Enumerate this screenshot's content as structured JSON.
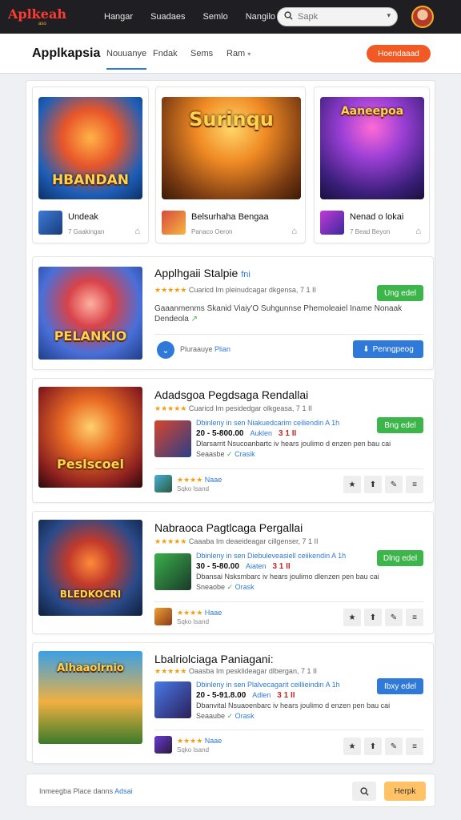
{
  "topbar": {
    "logo": "Aplkeah",
    "logo_sub": "aso",
    "nav": [
      "Hangar",
      "Suadaes",
      "Semlo",
      "Nangilo"
    ],
    "search_placeholder": "Sapk",
    "search_icon": "search-icon",
    "avatar_icon": "avatar"
  },
  "subnav": {
    "title": "Applkapsia",
    "tabs": [
      "Nouuanye",
      "Fndak",
      "Sems",
      "Ram"
    ],
    "cta": "Hoendaaad"
  },
  "tiles": [
    {
      "art_title": "HBANDAN",
      "name": "Undeak",
      "sub": "7 Gaakingan"
    },
    {
      "art_title": "Surinqu",
      "name": "Belsurhaha Bengaa",
      "sub": "Panaco Oeron"
    },
    {
      "art_title": "Aaneepoa",
      "name": "Nenad o lokai",
      "sub": "7 Bead Beyon"
    }
  ],
  "featured": {
    "art_label": "PELANKIO",
    "title": "Applhgaii  Stalpie",
    "title_suffix": "fni",
    "stars": "★★★★★",
    "rating_text": "Cuaricd Im pleinudcagar dkgensa, 7 1 II",
    "badge": "Ung edel",
    "desc": "Gaaanmenms Skanid Viaiy'O Suhgunnse Phemoleaiel Iname Nonaak Dendeola",
    "info_icon": "chevron-down-icon",
    "info_text": "Pluraauye",
    "info_link": "Plian",
    "download": "Penngpeog"
  },
  "cards": [
    {
      "art_label": "Peslscoel",
      "title": "Adadsgoa  Pegdsaga  Rendallai",
      "stars": "★★★★★",
      "rating_text": "Cuaricd Im pesidedgar olkgeasa, 7 1 II",
      "badge": "Bng edel",
      "badge_color": "green",
      "l1": "Dbinleny in sen Niakuedcarim ceiliendin A 1h",
      "l2_price": "20 - 5-800.00",
      "l2_a": "Auklen",
      "l2_s": "3 1 II",
      "l3": "Dlarsarrit Nsucoanbartc iv hears joulimo d enzen pen bau cai",
      "l4_pre": "Seaasbe",
      "l4_ok": "✓",
      "l4_cr": "Crasik",
      "mini_stars": "★★★★",
      "mini_new": "Naae",
      "mini_sub": "Sqko Isand"
    },
    {
      "art_label": "BLEDKOCRI",
      "title": "Nabraoca  Pagtlcaga  Pergallai",
      "stars": "★★★★★",
      "rating_text": "Caaaba Im deaeideagar cillgenser, 7 1 II",
      "badge": "Dlng edel",
      "badge_color": "green",
      "l1": "Dbinleny in sen Diebuleveasiell ceiikendin A 1h",
      "l2_price": "30 - 5-80.00",
      "l2_a": "Aiaten",
      "l2_s": "3 1 II",
      "l3": "Dbansai Nsksmbarc iv hears joulimo dlenzen pen bau cai",
      "l4_pre": "Sneaobe",
      "l4_ok": "✓",
      "l4_cr": "Orask",
      "mini_stars": "★★★★",
      "mini_new": "Haae",
      "mini_sub": "Sqko Isand"
    },
    {
      "art_label": "Alhaaolrnio",
      "title": "Lbalriolciaga  Paniagani:",
      "stars": "★★★★★",
      "rating_text": "Oaasba Im pesklideagar dlbergan, 7 1 II",
      "badge": "Ibxy edel",
      "badge_color": "blue",
      "l1": "Dbinleny in sen Plalvecagarit ceillieindin A 1h",
      "l2_price": "20 - 5-91.8.00",
      "l2_a": "Adlen",
      "l2_s": "3 1 II",
      "l3": "Dbanvital Nsuaoenbarc iv hears joulimo d enzen pen bau cai",
      "l4_pre": "Seaaube",
      "l4_ok": "✓",
      "l4_cr": "Orask",
      "mini_stars": "★★★★",
      "mini_new": "Naae",
      "mini_sub": "Sqko Isand"
    }
  ],
  "footer": {
    "text": "Inmeegba  Place  danns",
    "link": "Adsai",
    "help": "Herpk"
  },
  "colors": {
    "accent_blue": "#2f7ad8",
    "accent_green": "#3cb54a",
    "cta_orange": "#f15a24",
    "topbar": "#1f1f23"
  }
}
